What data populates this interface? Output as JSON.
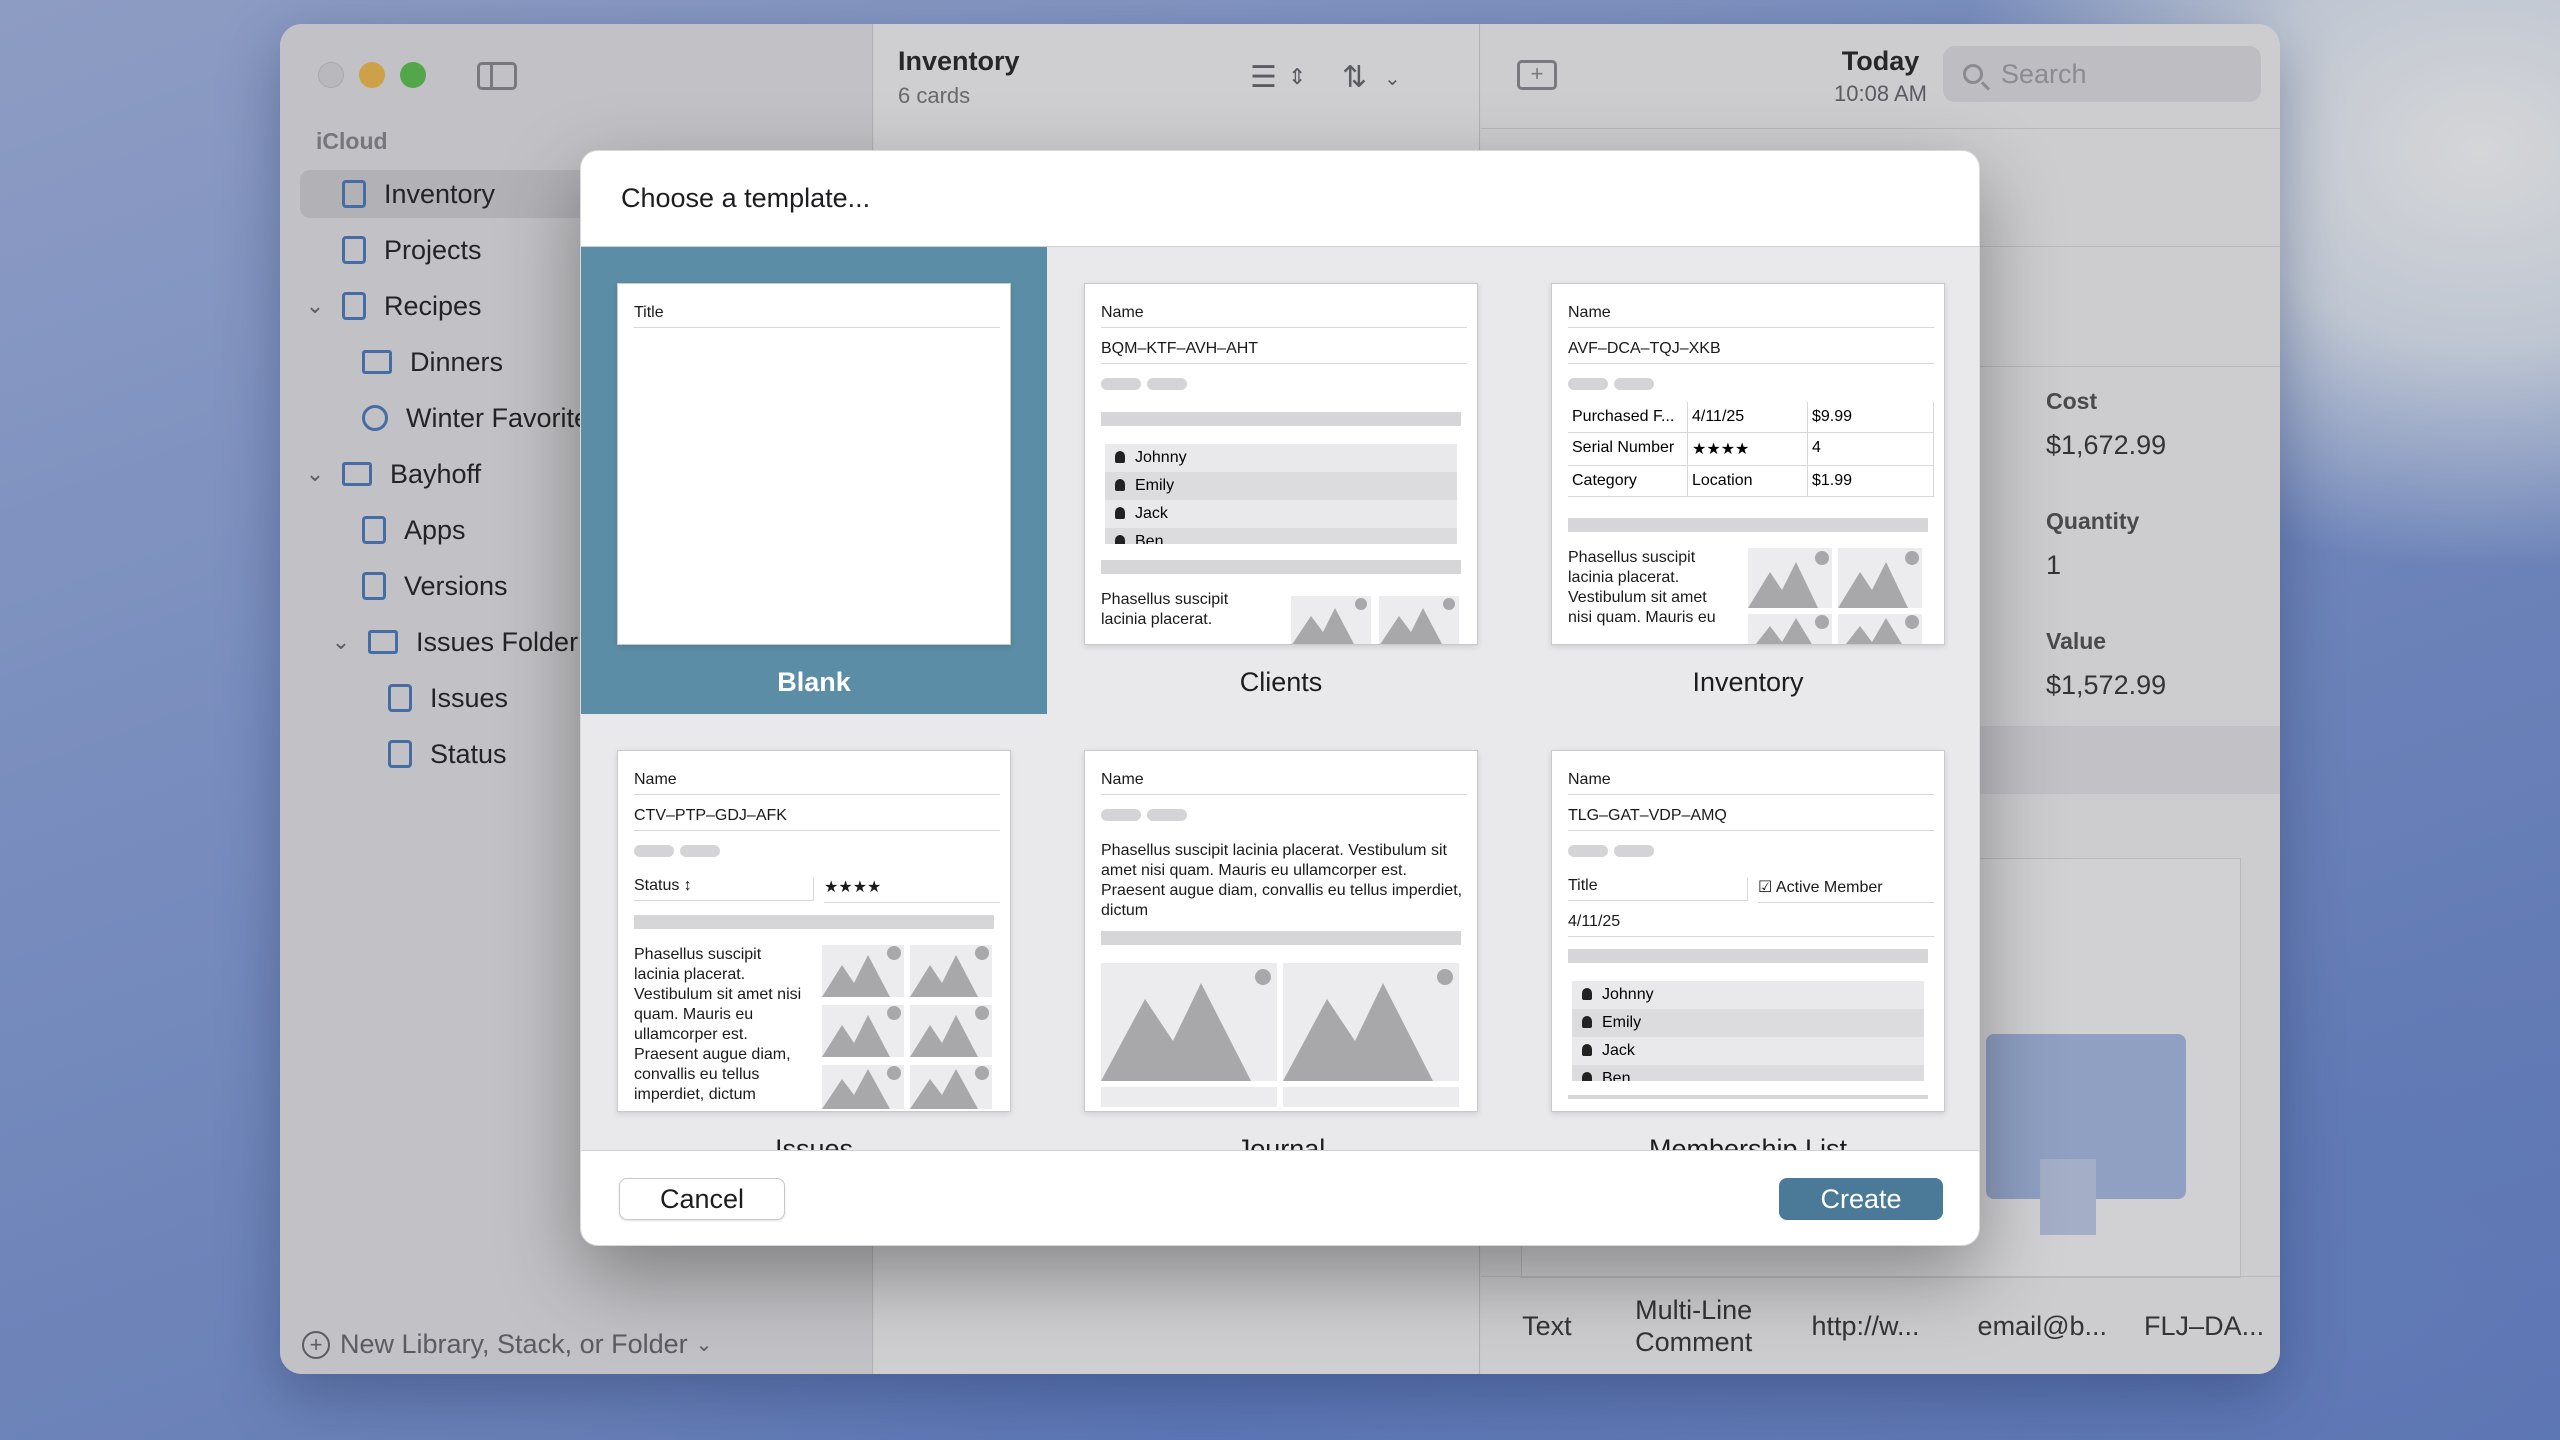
{
  "window": {
    "sidebar": {
      "section": "iCloud",
      "items": [
        {
          "label": "Inventory",
          "icon": "stack-icon",
          "selected": true
        },
        {
          "label": "Projects",
          "icon": "stack-icon"
        },
        {
          "label": "Recipes",
          "icon": "stack-icon",
          "disclosure": "expanded"
        },
        {
          "label": "Dinners",
          "icon": "folder-icon"
        },
        {
          "label": "Winter Favorites",
          "icon": "smart-stack-icon"
        },
        {
          "label": "Bayhoff",
          "icon": "folder-icon",
          "disclosure": "expanded"
        },
        {
          "label": "Apps",
          "icon": "stack-icon"
        },
        {
          "label": "Versions",
          "icon": "stack-icon"
        },
        {
          "label": "Issues Folder",
          "icon": "folder-icon",
          "disclosure": "expanded"
        },
        {
          "label": "Issues",
          "icon": "stack-icon"
        },
        {
          "label": "Status",
          "icon": "stack-icon"
        }
      ],
      "footer": "New Library, Stack, or Folder"
    },
    "list": {
      "title": "Inventory",
      "subtitle": "6 cards"
    },
    "detail": {
      "date": "Today",
      "time": "10:08 AM",
      "search_placeholder": "Search",
      "fields": [
        {
          "label": "Cost",
          "value": "$1,672.99"
        },
        {
          "label": "Quantity",
          "value": "1"
        },
        {
          "label": "Value",
          "value": "$1,572.99"
        }
      ],
      "field_tabs": [
        "Text",
        "Multi-Line Comment",
        "http://w...",
        "email@b...",
        "FLJ–DA..."
      ]
    }
  },
  "dialog": {
    "title": "Choose a template...",
    "templates": [
      {
        "name": "Blank",
        "selected": true,
        "field": "Title"
      },
      {
        "name": "Clients",
        "field": "Name",
        "code": "BQM–KTF–AVH–AHT",
        "people": [
          "Johnny",
          "Emily",
          "Jack",
          "Ben"
        ],
        "text": "Phasellus suscipit lacinia placerat."
      },
      {
        "name": "Inventory",
        "field": "Name",
        "code": "AVF–DCA–TQJ–XKB",
        "rows": [
          [
            "Purchased F...",
            "4/11/25",
            "$9.99"
          ],
          [
            "Serial Number",
            "★★★★",
            "4"
          ],
          [
            "Category",
            "Location",
            "$1.99"
          ]
        ],
        "text": "Phasellus suscipit lacinia placerat. Vestibulum sit amet nisi quam. Mauris eu"
      },
      {
        "name": "Issues",
        "field": "Name",
        "code": "CTV–PTP–GDJ–AFK",
        "status": "Status ↕",
        "stars": "★★★★",
        "text": "Phasellus suscipit lacinia placerat. Vestibulum sit amet nisi quam. Mauris eu ullamcorper est. Praesent augue diam, convallis eu tellus imperdiet, dictum"
      },
      {
        "name": "Journal",
        "field": "Name",
        "text": "Phasellus suscipit lacinia placerat. Vestibulum sit amet nisi quam. Mauris eu ullamcorper est. Praesent augue diam, convallis eu tellus imperdiet, dictum"
      },
      {
        "name": "Membership List",
        "field": "Name",
        "code": "TLG–GAT–VDP–AMQ",
        "title_field": "Title",
        "checkbox": "☑ Active Member",
        "date": "4/11/25",
        "people": [
          "Johnny",
          "Emily",
          "Jack",
          "Ben"
        ]
      }
    ],
    "cancel": "Cancel",
    "create": "Create"
  },
  "colors": {
    "selection": "#5b8ea6",
    "create_button": "#4a7a97",
    "icon_accent": "#4f7fc0"
  }
}
